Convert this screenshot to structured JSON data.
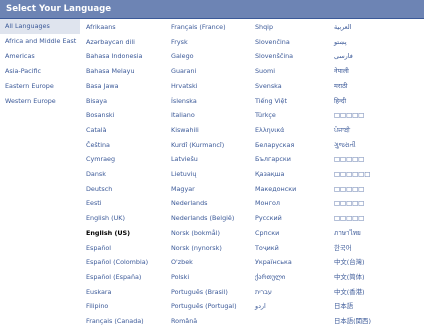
{
  "header": {
    "title": "Select Your Language"
  },
  "sidebar": {
    "regions": [
      "All Languages",
      "Africa and Middle East",
      "Americas",
      "Asia-Pacific",
      "Eastern Europe",
      "Western Europe"
    ]
  },
  "columns": [
    [
      "Afrikaans",
      "Azərbaycan dili",
      "Bahasa Indonesia",
      "Bahasa Melayu",
      "Basa Jawa",
      "Bisaya",
      "Bosanski",
      "Català",
      "Čeština",
      "Cymraeg",
      "Dansk",
      "Deutsch",
      "Eesti",
      "English (UK)",
      "English (US)",
      "Español",
      "Español (Colombia)",
      "Español (España)",
      "Euskara",
      "Filipino",
      "Français (Canada)"
    ],
    [
      "Français (France)",
      "Frysk",
      "Galego",
      "Guarani",
      "Hrvatski",
      "Íslenska",
      "Italiano",
      "Kiswahili",
      "Kurdî (Kurmancî)",
      "Latviešu",
      "Lietuvių",
      "Magyar",
      "Nederlands",
      "Nederlands (België)",
      "Norsk (bokmål)",
      "Norsk (nynorsk)",
      "O'zbek",
      "Polski",
      "Português (Brasil)",
      "Português (Portugal)",
      "Română"
    ],
    [
      "Shqip",
      "Slovenčina",
      "Slovenščina",
      "Suomi",
      "Svenska",
      "Tiếng Việt",
      "Türkçe",
      "Ελληνικά",
      "Беларуская",
      "Български",
      "Қазақша",
      "Македонски",
      "Монгол",
      "Русский",
      "Српски",
      "Тоҷикӣ",
      "Українська",
      "ქართული",
      "עברית",
      "اردو",
      ""
    ],
    [
      "العربية",
      "پښتو",
      "فارسی",
      "नेपाली",
      "मराठी",
      "हिन्दी",
      "□□□□□",
      "ਪੰਜਾਬੀ",
      "ગુજરાતી",
      "□□□□□",
      "□□□□□□",
      "□□□□□",
      "□□□□□",
      "□□□□□",
      "ภาษาไทย",
      "한국어",
      "中文(台灣)",
      "中文(简体)",
      "中文(香港)",
      "日本語",
      "日本語(関西)"
    ]
  ],
  "current_language": "English (US)",
  "colors": {
    "header_bg": "#6d84b4",
    "link": "#3b5998",
    "selected_bg": "#dfe4ee"
  }
}
